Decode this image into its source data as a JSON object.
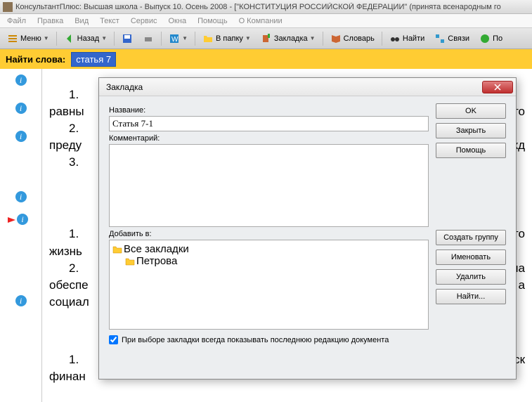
{
  "titlebar": {
    "text": "КонсультантПлюс: Высшая школа - Выпуск 10. Осень 2008 - [\"КОНСТИТУЦИЯ РОССИЙСКОЙ ФЕДЕРАЦИИ\" (принята всенародным го"
  },
  "menubar": {
    "items": [
      "Файл",
      "Правка",
      "Вид",
      "Текст",
      "Сервис",
      "Окна",
      "Помощь",
      "О Компании"
    ]
  },
  "toolbar": {
    "menu": "Меню",
    "back": "Назад",
    "folder": "В папку",
    "bookmark": "Закладка",
    "dictionary": "Словарь",
    "find": "Найти",
    "links": "Связи",
    "po": "По"
  },
  "findbar": {
    "label": "Найти слова:",
    "value": "статья 7"
  },
  "doc": {
    "p1": "1.",
    "p1r": "равны",
    "p2": "2.",
    "p2r": "преду",
    "p3": "3.",
    "p4": "1.",
    "p4r": "жизнь",
    "p5": "2.",
    "p5r": "обеспе",
    "p6r": "социал",
    "p7": "1.",
    "p7r": "финан",
    "r1": "то",
    "r2": "жд",
    "r3": "го",
    "r4": "на",
    "r5": "а",
    "r7": "ск"
  },
  "dialog": {
    "title": "Закладка",
    "name_label": "Название:",
    "name_value": "Статья 7-1",
    "comment_label": "Комментарий:",
    "addto_label": "Добавить в:",
    "tree_root": "Все закладки",
    "tree_child": "Петрова",
    "check_label": "При выборе закладки всегда показывать последнюю редакцию документа",
    "btn_ok": "OK",
    "btn_close": "Закрыть",
    "btn_help": "Помощь",
    "btn_group": "Создать группу",
    "btn_rename": "Именовать",
    "btn_delete": "Удалить",
    "btn_find": "Найти..."
  }
}
